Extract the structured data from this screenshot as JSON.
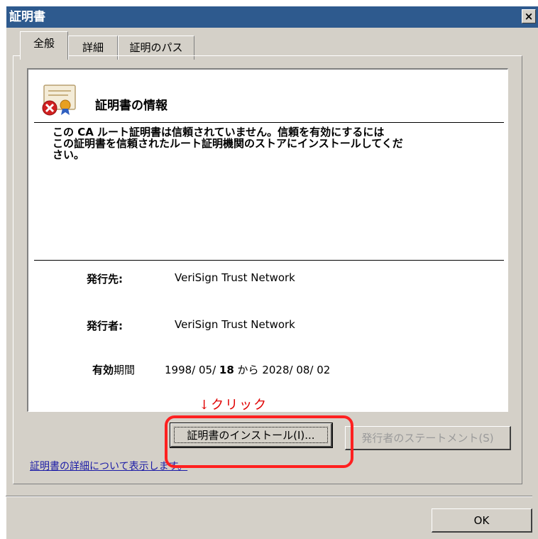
{
  "window": {
    "title": "証明書",
    "close_label": "×"
  },
  "tabs": [
    {
      "label": "全般",
      "active": true
    },
    {
      "label": "詳細",
      "active": false
    },
    {
      "label": "証明のパス",
      "active": false
    }
  ],
  "info": {
    "title": "証明書の情報",
    "message": "この CA ルート証明書は信頼されていません。信頼を有効にするには\nこの証明書を信頼されたルート証明機関のストアにインストールしてくだ\nさい。",
    "issued_to_label": "発行先:",
    "issued_to": "VeriSign Trust Network",
    "issued_by_label": "発行者:",
    "issued_by": "VeriSign Trust Network",
    "validity_label_bold": "有効",
    "validity_label_rest": "期間",
    "valid_from_prefix": "1998/ 05/ ",
    "valid_from_day": "18",
    "valid_to_prefix": " から ",
    "valid_to": "2028/ 08/ 02"
  },
  "annotation": {
    "click_note": "↓クリック",
    "highlight_color": "#ff2020"
  },
  "buttons": {
    "install": "証明書のインストール(I)...",
    "issuer_statement": "発行者のステートメント(S)",
    "ok": "OK"
  },
  "link": {
    "details": "証明書の詳細について表示します。"
  },
  "colors": {
    "titlebar": "#2e5a8e",
    "dialog_bg": "#d4d0c8",
    "annotation_red": "#e00000"
  }
}
